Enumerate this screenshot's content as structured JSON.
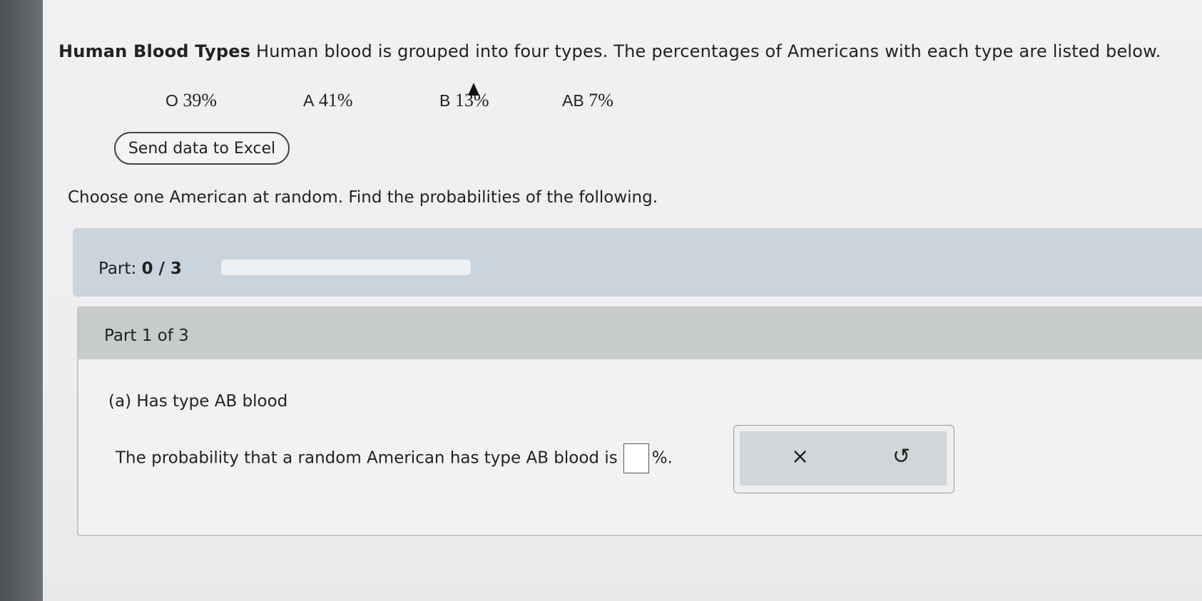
{
  "intro": {
    "title": "Human Blood Types",
    "text": "Human blood is grouped into four types. The percentages of Americans with each type are listed below."
  },
  "blood_types": [
    {
      "label": "O",
      "value": "39%"
    },
    {
      "label": "A",
      "value": "41%"
    },
    {
      "label": "B",
      "value": "13%"
    },
    {
      "label": "AB",
      "value": "7%"
    }
  ],
  "excel_button": "Send data to Excel",
  "instruction": "Choose one American at random. Find the probabilities of the following.",
  "part_status": {
    "prefix": "Part:",
    "value": "0 / 3",
    "progress": 0
  },
  "card": {
    "header": "Part 1 of 3",
    "question": "(a) Has type AB blood",
    "answer_prefix": "The probability that a random American has type AB blood is",
    "answer_value": "",
    "answer_suffix": "%."
  },
  "tools": {
    "clear_icon": "×",
    "undo_icon": "↺"
  }
}
